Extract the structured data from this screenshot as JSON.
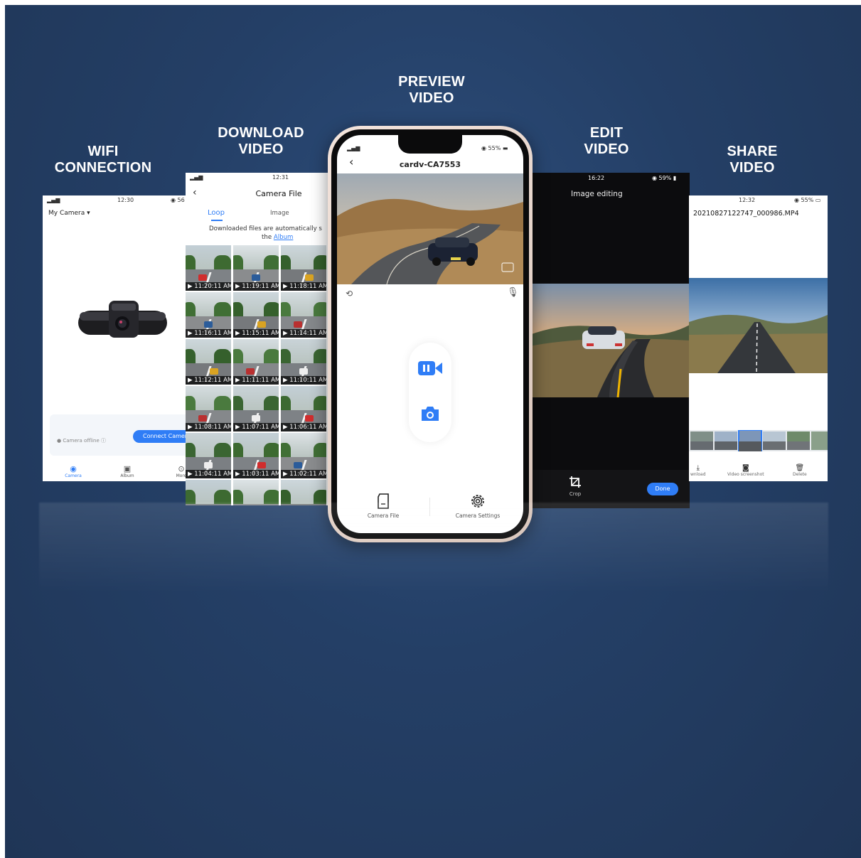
{
  "features": [
    {
      "line1": "WIFI",
      "line2": "CONNECTION"
    },
    {
      "line1": "DOWNLOAD",
      "line2": "VIDEO"
    },
    {
      "line1": "PREVIEW",
      "line2": "VIDEO"
    },
    {
      "line1": "EDIT",
      "line2": "VIDEO"
    },
    {
      "line1": "SHARE",
      "line2": "VIDEO"
    }
  ],
  "wifi_screen": {
    "time": "12:30",
    "battery": "56",
    "header": "My Camera",
    "status": "Camera offline",
    "connect_button": "Connect Camera",
    "tabs": [
      "Camera",
      "Album",
      "More"
    ]
  },
  "download_screen": {
    "time": "12:31",
    "title": "Camera File",
    "tabs": [
      "Loop",
      "Image"
    ],
    "notice": "Downloaded files are automatically s",
    "notice2": "the",
    "notice_link": "Album",
    "thumb_times": [
      "11:20:11 AM",
      "11:19:11 AM",
      "11:18:11 AM",
      "11:16:11 AM",
      "11:15:11 AM",
      "11:14:11 AM",
      "11:12:11 AM",
      "11:11:11 AM",
      "11:10:11 AM",
      "11:08:11 AM",
      "11:07:11 AM",
      "11:06:11 AM",
      "11:04:11 AM",
      "11:03:11 AM",
      "11:02:11 AM"
    ]
  },
  "preview_screen": {
    "battery": "55%",
    "title": "cardv-CA7553",
    "bottom_tabs": [
      "Camera File",
      "Camera Settings"
    ]
  },
  "edit_screen": {
    "time": "16:22",
    "battery": "59%",
    "title": "Image editing",
    "crop_label": "Crop",
    "done_button": "Done"
  },
  "share_screen": {
    "time": "12:32",
    "battery": "55%",
    "filename": "20210827122747_000986.MP4",
    "actions": [
      "wnload",
      "Video screenshot",
      "Delete"
    ]
  },
  "colors": {
    "accent": "#2f7df6",
    "background": "#243f66"
  }
}
